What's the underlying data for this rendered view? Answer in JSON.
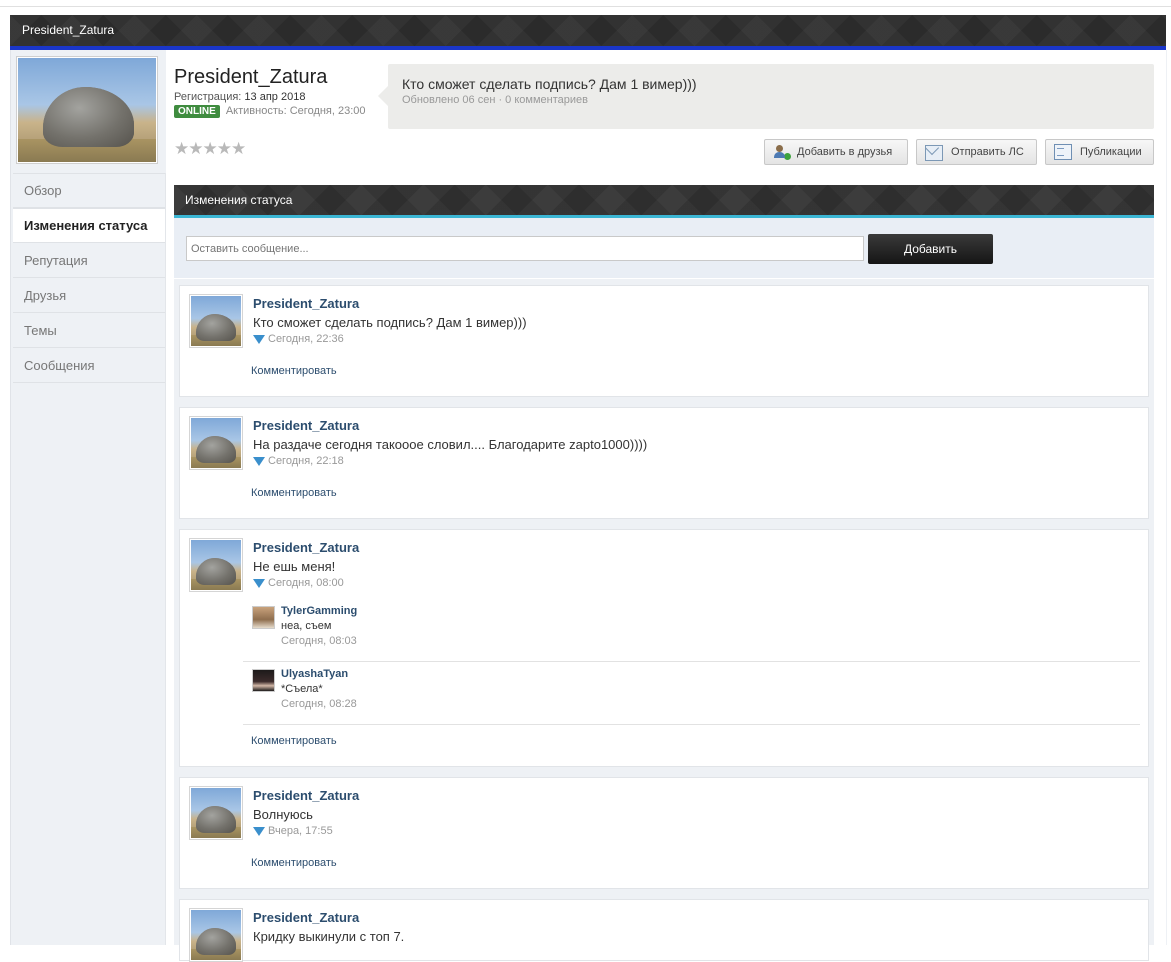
{
  "window": {
    "title": "President_Zatura"
  },
  "profile": {
    "name": "President_Zatura",
    "registration_label": "Регистрация:",
    "registration_date": "13 апр 2018",
    "online_badge": "ONLINE",
    "activity_label": "Активность:",
    "activity_value": "Сегодня, 23:00",
    "rating_stars": "★★★★★",
    "status_text": "Кто сможет сделать подпись? Дам 1 вимер)))",
    "status_meta": "Обновлено 06 сен · 0 комментариев"
  },
  "actions": {
    "add_friend": "Добавить в друзья",
    "send_pm": "Отправить ЛС",
    "publications": "Публикации"
  },
  "nav": {
    "items": [
      {
        "label": "Обзор"
      },
      {
        "label": "Изменения статуса"
      },
      {
        "label": "Репутация"
      },
      {
        "label": "Друзья"
      },
      {
        "label": "Темы"
      },
      {
        "label": "Сообщения"
      }
    ],
    "active_index": 1
  },
  "section": {
    "title": "Изменения статуса"
  },
  "compose": {
    "placeholder": "Оставить сообщение...",
    "submit_label": "Добавить"
  },
  "feed": {
    "comment_label": "Комментировать",
    "posts": [
      {
        "author": "President_Zatura",
        "text": "Кто сможет сделать подпись? Дам 1 вимер)))",
        "time": "Сегодня, 22:36"
      },
      {
        "author": "President_Zatura",
        "text": "На раздаче сегодня такоооe словил.... Благодарите zapto1000))))",
        "time": "Сегодня, 22:18"
      },
      {
        "author": "President_Zatura",
        "text": "Не ешь меня!",
        "time": "Сегодня, 08:00",
        "replies": [
          {
            "author": "TylerGamming",
            "text": "неа, съем",
            "time": "Сегодня, 08:03"
          },
          {
            "author": "UlyashaTyan",
            "text": "*Съела*",
            "time": "Сегодня, 08:28"
          }
        ]
      },
      {
        "author": "President_Zatura",
        "text": "Волнуюсь",
        "time": "Вчера, 17:55"
      },
      {
        "author": "President_Zatura",
        "text": "Кридку выкинули с топ 7.",
        "time": ""
      }
    ]
  }
}
